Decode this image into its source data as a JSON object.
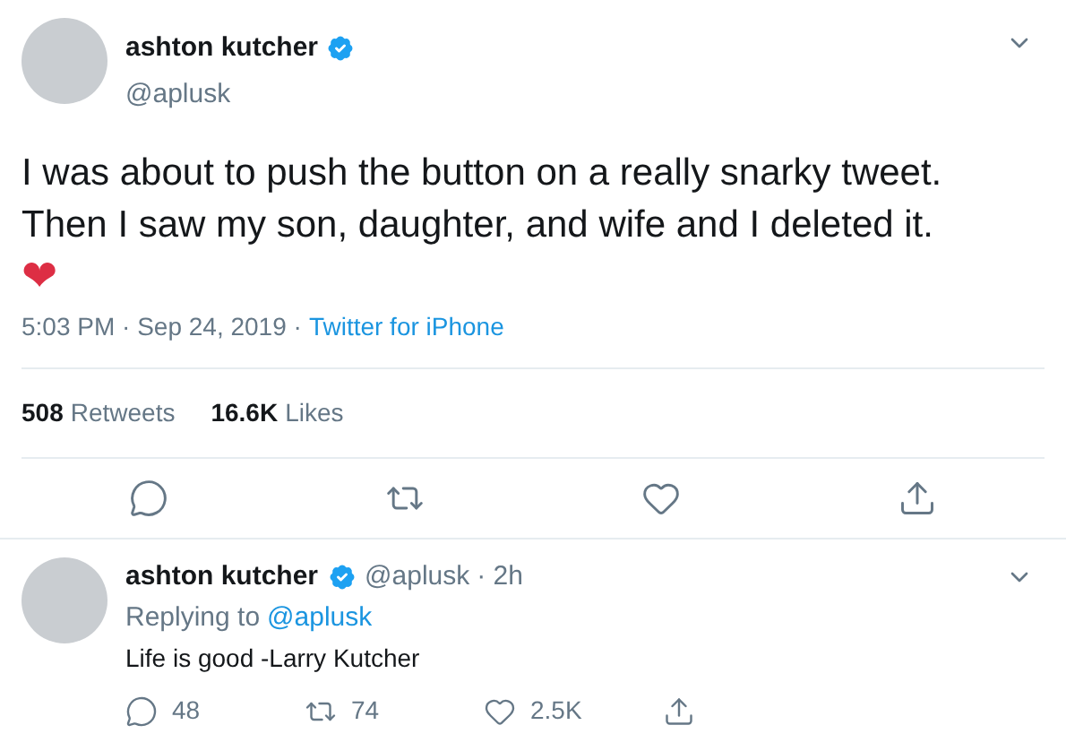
{
  "tweet": {
    "author": {
      "name": "ashton kutcher",
      "handle": "@aplusk",
      "verified": true
    },
    "text": "I was about to push the button on a really snarky tweet. Then I saw my son, daughter, and wife and I deleted it.",
    "emoji": "❤",
    "meta": "5:03 PM · Sep 24, 2019 ·",
    "source": "Twitter for iPhone",
    "stats": [
      {
        "count": "508",
        "label": "Retweets"
      },
      {
        "count": "16.6K",
        "label": "Likes"
      }
    ],
    "actions": [
      {
        "kind": "reply"
      },
      {
        "kind": "retweet"
      },
      {
        "kind": "like"
      },
      {
        "kind": "share"
      }
    ]
  },
  "reply": {
    "author": {
      "name": "ashton kutcher",
      "handle": "@aplusk",
      "verified": true
    },
    "time": "· 2h",
    "replying_prefix": "Replying to",
    "replying_handle": "@aplusk",
    "text": "Life is good -Larry Kutcher",
    "actions": [
      {
        "kind": "reply",
        "count": "48"
      },
      {
        "kind": "retweet",
        "count": "74"
      },
      {
        "kind": "like",
        "count": "2.5K"
      },
      {
        "kind": "share"
      }
    ]
  }
}
